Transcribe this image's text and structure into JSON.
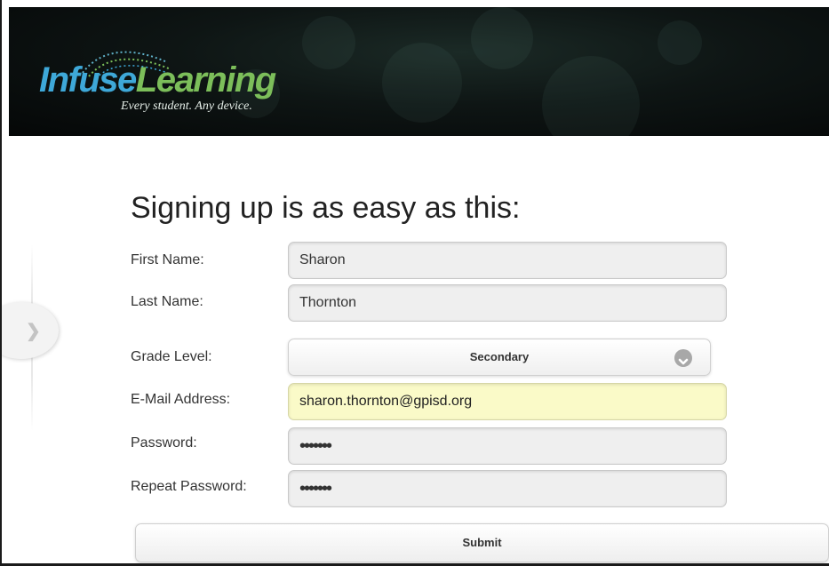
{
  "header": {
    "logo_part1": "Infuse",
    "logo_part2": "Learning",
    "tagline": "Every student. Any device.",
    "colors": {
      "infuse": "#3ea8d8",
      "learning": "#7cbe5a",
      "background": "#0e1514"
    }
  },
  "form": {
    "title": "Signing up is as easy as this:",
    "first_name": {
      "label": "First Name:",
      "value": "Sharon"
    },
    "last_name": {
      "label": "Last Name:",
      "value": "Thornton"
    },
    "grade_level": {
      "label": "Grade Level:",
      "value": "Secondary",
      "icon": "chevron-down-icon"
    },
    "email": {
      "label": "E-Mail Address:",
      "value": "sharon.thornton@gpisd.org"
    },
    "password": {
      "label": "Password:",
      "value": "•••••••"
    },
    "repeat_password": {
      "label": "Repeat Password:",
      "value": "•••••••"
    },
    "submit_label": "Submit"
  },
  "side_panel": {
    "icon": "chevron-right-icon"
  }
}
